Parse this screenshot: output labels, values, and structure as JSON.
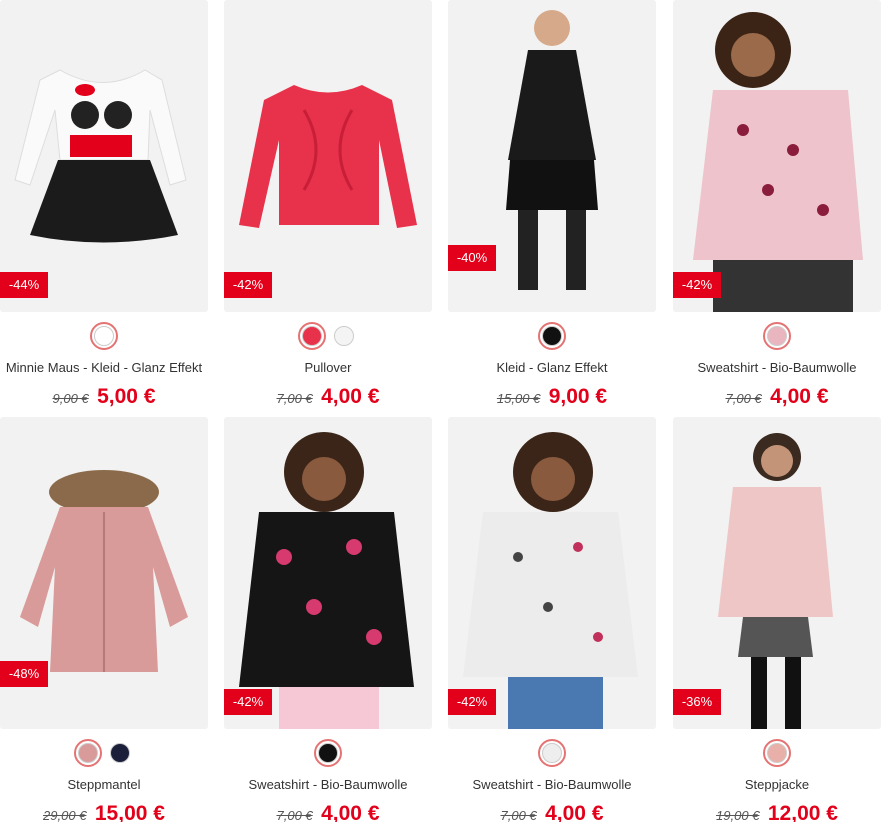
{
  "products": [
    {
      "name": "Minnie Maus - Kleid - Glanz Effekt",
      "discount": "-44%",
      "old_price": "9,00 €",
      "new_price": "5,00 €",
      "swatches": [
        {
          "color": "#ffffff",
          "selected": true
        }
      ]
    },
    {
      "name": "Pullover",
      "discount": "-42%",
      "old_price": "7,00 €",
      "new_price": "4,00 €",
      "swatches": [
        {
          "color": "#e8314a",
          "selected": true
        },
        {
          "color": "#f4f4f4",
          "selected": false
        }
      ]
    },
    {
      "name": "Kleid - Glanz Effekt",
      "discount": "-40%",
      "old_price": "15,00 €",
      "new_price": "9,00 €",
      "swatches": [
        {
          "color": "#111111",
          "selected": true
        }
      ]
    },
    {
      "name": "Sweatshirt - Bio-Baumwolle",
      "discount": "-42%",
      "old_price": "7,00 €",
      "new_price": "4,00 €",
      "swatches": [
        {
          "color": "#e9b6c0",
          "selected": true
        }
      ]
    },
    {
      "name": "Steppmantel",
      "discount": "-48%",
      "old_price": "29,00 €",
      "new_price": "15,00 €",
      "swatches": [
        {
          "color": "#d99a9a",
          "selected": true
        },
        {
          "color": "#1c1f3a",
          "selected": false
        }
      ]
    },
    {
      "name": "Sweatshirt - Bio-Baumwolle",
      "discount": "-42%",
      "old_price": "7,00 €",
      "new_price": "4,00 €",
      "swatches": [
        {
          "color": "#111111",
          "selected": true
        }
      ]
    },
    {
      "name": "Sweatshirt - Bio-Baumwolle",
      "discount": "-42%",
      "old_price": "7,00 €",
      "new_price": "4,00 €",
      "swatches": [
        {
          "color": "#eeeeee",
          "selected": true
        }
      ]
    },
    {
      "name": "Steppjacke",
      "discount": "-36%",
      "old_price": "19,00 €",
      "new_price": "12,00 €",
      "swatches": [
        {
          "color": "#e8b0a8",
          "selected": true
        }
      ]
    }
  ],
  "colors": {
    "accent": "#e2001a",
    "image_bg": "#f2f2f2"
  }
}
